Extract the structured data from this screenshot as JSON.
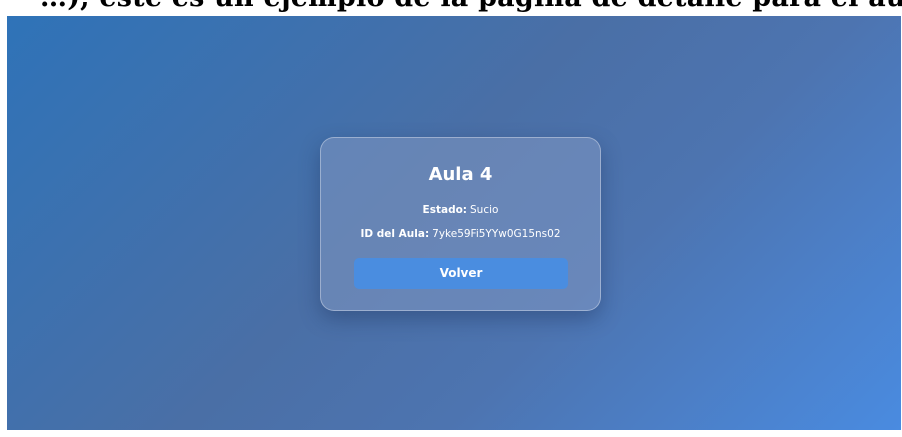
{
  "header_caption": "…),  este es un ejemplo de la página de detalle para el aula de  [clipped]",
  "card": {
    "title": "Aula 4",
    "state_label": "Estado:",
    "state_value": "Sucio",
    "id_label": "ID del Aula:",
    "id_value": "7yke59Fi5YYw0G15ns02",
    "back_button_label": "Volver"
  },
  "colors": {
    "background_start": "#2f73b8",
    "background_end": "#4a8be0",
    "button": "#4a8de0",
    "text": "#ffffff"
  }
}
